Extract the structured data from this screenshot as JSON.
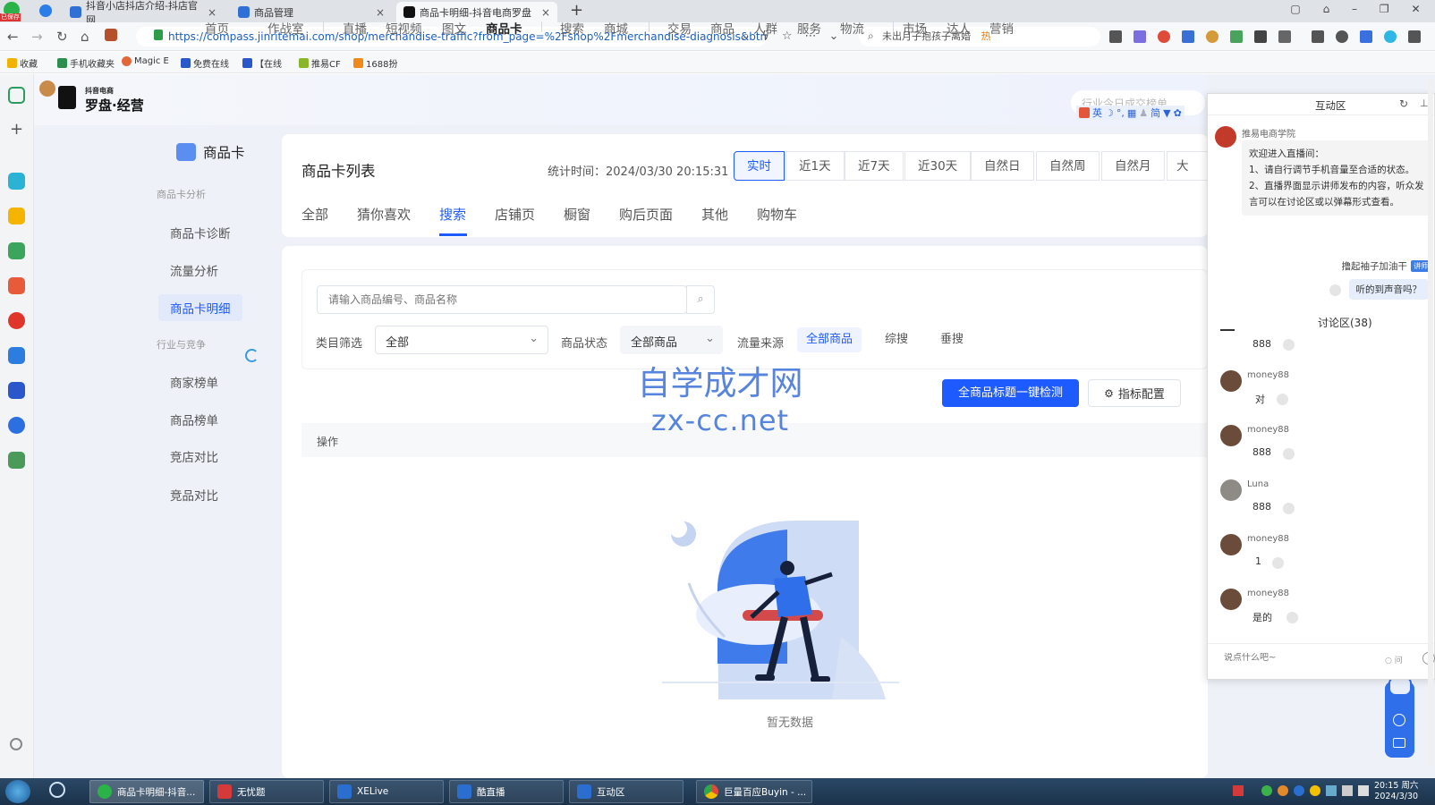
{
  "browser": {
    "badge": "已保存",
    "tabs": [
      {
        "title": "抖音小店抖店介绍-抖店官网",
        "active": false
      },
      {
        "title": "商品管理",
        "active": false
      },
      {
        "title": "商品卡明细-抖音电商罗盘",
        "active": true
      }
    ],
    "url": "https://compass.jinritemai.com/shop/merchandise-traffic?from_page=%2Fshop%2Fmerchandise-diagnosis&btm",
    "search_text": "未出月子抱孩子离婚",
    "search_hot": "热",
    "bookmarks": [
      "收藏",
      "手机收藏夹",
      "Magic E",
      "免费在线",
      "【在线",
      "推易CF",
      "1688扮"
    ]
  },
  "app": {
    "brand_small": "抖音电商",
    "brand": "罗盘·经营",
    "nav": [
      "首页",
      "作战室",
      "直播",
      "短视频",
      "图文",
      "商品卡",
      "搜索",
      "商城",
      "交易",
      "商品",
      "人群",
      "服务",
      "物流",
      "市场",
      "达人",
      "营销"
    ],
    "nav_active": "商品卡",
    "nav_search_placeholder": "行业今日成交榜单",
    "sidebar": {
      "title": "商品卡",
      "group1": "商品卡分析",
      "items1": [
        "商品卡诊断",
        "流量分析",
        "商品卡明细"
      ],
      "active": "商品卡明细",
      "group2": "行业与竞争",
      "items2": [
        "商家榜单",
        "商品榜单",
        "竞店对比",
        "竞品对比"
      ]
    },
    "main": {
      "title": "商品卡列表",
      "stats_time": "统计时间：2024/03/30 20:15:31",
      "time_buttons": [
        "实时",
        "近1天",
        "近7天",
        "近30天",
        "自然日",
        "自然周",
        "自然月",
        "大促"
      ],
      "time_active": "实时",
      "tabs": [
        "全部",
        "猜你喜欢",
        "搜索",
        "店铺页",
        "橱窗",
        "购后页面",
        "其他",
        "购物车"
      ],
      "tab_active": "搜索",
      "search_placeholder": "请输入商品编号、商品名称",
      "category_label": "类目筛选",
      "category_value": "全部",
      "status_label": "商品状态",
      "status_value": "全部商品",
      "source_label": "流量来源",
      "sources": [
        "全部商品",
        "综搜",
        "垂搜"
      ],
      "source_active": "全部商品",
      "btn_check": "全商品标题一键检测",
      "btn_config": "指标配置",
      "column_header": "操作",
      "empty_text": "暂无数据"
    },
    "watermark": {
      "line1": "自学成才网",
      "line2": "zx-cc.net"
    }
  },
  "chat": {
    "title": "互动区",
    "host_name": "推易电商学院",
    "welcome_1": "欢迎进入直播间：",
    "welcome_2": "1、请自行调节手机音量至合适的状态。",
    "welcome_3": "2、直播界面显示讲师发布的内容，听众发言可以在讨论区或以弹幕形式查看。",
    "teacher_name": "撸起袖子加油干",
    "teacher_tag": "讲师",
    "teacher_msg": "听的到声音吗？",
    "discussion": "讨论区(38)",
    "messages": [
      {
        "user": "",
        "text": "888"
      },
      {
        "user": "money88",
        "text": "对"
      },
      {
        "user": "money88",
        "text": "888"
      },
      {
        "user": "Luna",
        "text": "888"
      },
      {
        "user": "money88",
        "text": "1"
      },
      {
        "user": "money88",
        "text": "是的"
      }
    ],
    "input_placeholder": "说点什么吧~",
    "ask_label": "问"
  },
  "taskbar": {
    "tasks": [
      "商品卡明细-抖音...",
      "无忧题",
      "XELive",
      "酷直播",
      "互动区",
      "巨量百应Buyin - ..."
    ],
    "time": "20:15 周六",
    "date": "2024/3/30"
  },
  "colors": {
    "accent": "#1e5bff",
    "taskbar": "#1b324a"
  }
}
